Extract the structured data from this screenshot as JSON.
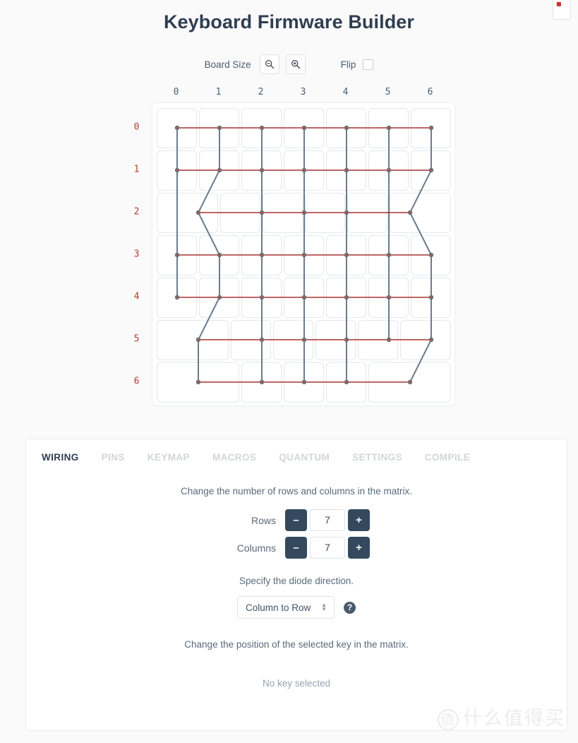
{
  "header": {
    "title": "Keyboard Firmware Builder"
  },
  "toolbar": {
    "board_size_label": "Board Size",
    "zoom_out_icon": "zoom-out-icon",
    "zoom_in_icon": "zoom-in-icon",
    "flip_label": "Flip",
    "flip_checked": false
  },
  "matrix": {
    "col_labels": [
      "0",
      "1",
      "2",
      "3",
      "4",
      "5",
      "6"
    ],
    "row_labels": [
      "0",
      "1",
      "2",
      "3",
      "4",
      "5",
      "6"
    ],
    "rows": 7,
    "cols": 7,
    "colors": {
      "row_wire": "#a83232",
      "col_wire": "#6b7c8c",
      "node": "#7a6a6a",
      "col_label": "#4a6076",
      "row_label": "#c0392b"
    },
    "layout": [
      {
        "row": 0,
        "keys": [
          {
            "x": 0,
            "w": 1
          },
          {
            "x": 1,
            "w": 1
          },
          {
            "x": 2,
            "w": 1
          },
          {
            "x": 3,
            "w": 1
          },
          {
            "x": 4,
            "w": 1
          },
          {
            "x": 5,
            "w": 1
          },
          {
            "x": 6,
            "w": 1
          }
        ]
      },
      {
        "row": 1,
        "keys": [
          {
            "x": 0,
            "w": 1
          },
          {
            "x": 1,
            "w": 1
          },
          {
            "x": 2,
            "w": 1
          },
          {
            "x": 3,
            "w": 1
          },
          {
            "x": 4,
            "w": 1
          },
          {
            "x": 5,
            "w": 1
          },
          {
            "x": 6,
            "w": 1
          }
        ]
      },
      {
        "row": 2,
        "keys": [
          {
            "x": 0,
            "w": 1.5
          },
          {
            "x": 1.5,
            "w": 1
          },
          {
            "x": 2.5,
            "w": 1
          },
          {
            "x": 3.5,
            "w": 1
          },
          {
            "x": 4.5,
            "w": 1
          },
          {
            "x": 5.5,
            "w": 1.5
          }
        ]
      },
      {
        "row": 3,
        "keys": [
          {
            "x": 0,
            "w": 1
          },
          {
            "x": 1,
            "w": 1
          },
          {
            "x": 2,
            "w": 1
          },
          {
            "x": 3,
            "w": 1
          },
          {
            "x": 4,
            "w": 1
          },
          {
            "x": 5,
            "w": 1
          },
          {
            "x": 6,
            "w": 1
          }
        ]
      },
      {
        "row": 4,
        "keys": [
          {
            "x": 0,
            "w": 1
          },
          {
            "x": 1,
            "w": 1
          },
          {
            "x": 2,
            "w": 1
          },
          {
            "x": 3,
            "w": 1
          },
          {
            "x": 4,
            "w": 1
          },
          {
            "x": 5,
            "w": 1
          },
          {
            "x": 6,
            "w": 1
          }
        ]
      },
      {
        "row": 5,
        "keys": [
          {
            "x": 0,
            "w": 1.75
          },
          {
            "x": 1.75,
            "w": 1
          },
          {
            "x": 2.75,
            "w": 1
          },
          {
            "x": 3.75,
            "w": 1
          },
          {
            "x": 4.75,
            "w": 1
          },
          {
            "x": 5.75,
            "w": 1.25
          }
        ]
      },
      {
        "row": 6,
        "keys": [
          {
            "x": 0,
            "w": 2
          },
          {
            "x": 2,
            "w": 1
          },
          {
            "x": 3,
            "w": 1
          },
          {
            "x": 4,
            "w": 1
          },
          {
            "x": 5,
            "w": 2
          }
        ]
      }
    ],
    "nodes": [
      {
        "row": 0,
        "xs": [
          0.5,
          1.5,
          2.5,
          3.5,
          4.5,
          5.5,
          6.5
        ]
      },
      {
        "row": 1,
        "xs": [
          0.5,
          1.5,
          2.5,
          3.5,
          4.5,
          5.5,
          6.5
        ]
      },
      {
        "row": 2,
        "xs": [
          1.0,
          2.5,
          3.5,
          4.5,
          6.0
        ]
      },
      {
        "row": 3,
        "xs": [
          0.5,
          1.5,
          2.5,
          3.5,
          4.5,
          5.5,
          6.5
        ]
      },
      {
        "row": 4,
        "xs": [
          0.5,
          1.5,
          2.5,
          3.5,
          4.5,
          5.5,
          6.5
        ]
      },
      {
        "row": 5,
        "xs": [
          1.0,
          2.5,
          3.5,
          4.5,
          5.5,
          6.5
        ]
      },
      {
        "row": 6,
        "xs": [
          1.0,
          2.5,
          3.5,
          4.5,
          6.0
        ]
      }
    ],
    "col_paths": [
      {
        "col": 0,
        "points": [
          [
            0.5,
            0
          ],
          [
            0.5,
            1
          ],
          [
            0.5,
            3
          ],
          [
            0.5,
            4
          ]
        ]
      },
      {
        "col": 1,
        "points": [
          [
            1.5,
            0
          ],
          [
            1.5,
            1
          ],
          [
            1.0,
            2
          ],
          [
            1.5,
            3
          ],
          [
            1.5,
            4
          ],
          [
            1.0,
            5
          ],
          [
            1.0,
            6
          ]
        ]
      },
      {
        "col": 2,
        "points": [
          [
            2.5,
            0
          ],
          [
            2.5,
            1
          ],
          [
            2.5,
            2
          ],
          [
            2.5,
            3
          ],
          [
            2.5,
            4
          ],
          [
            2.5,
            5
          ],
          [
            2.5,
            6
          ]
        ]
      },
      {
        "col": 3,
        "points": [
          [
            3.5,
            0
          ],
          [
            3.5,
            1
          ],
          [
            3.5,
            2
          ],
          [
            3.5,
            3
          ],
          [
            3.5,
            4
          ],
          [
            3.5,
            5
          ],
          [
            3.5,
            6
          ]
        ]
      },
      {
        "col": 4,
        "points": [
          [
            4.5,
            0
          ],
          [
            4.5,
            1
          ],
          [
            4.5,
            2
          ],
          [
            4.5,
            3
          ],
          [
            4.5,
            4
          ],
          [
            4.5,
            5
          ],
          [
            4.5,
            6
          ]
        ]
      },
      {
        "col": 5,
        "points": [
          [
            5.5,
            0
          ],
          [
            5.5,
            1
          ],
          [
            5.5,
            3
          ],
          [
            5.5,
            4
          ],
          [
            5.5,
            5
          ]
        ]
      },
      {
        "col": 6,
        "points": [
          [
            6.5,
            0
          ],
          [
            6.5,
            1
          ],
          [
            6.0,
            2
          ],
          [
            6.5,
            3
          ],
          [
            6.5,
            4
          ],
          [
            6.5,
            5
          ],
          [
            6.0,
            6
          ]
        ]
      }
    ]
  },
  "panel": {
    "tabs": [
      {
        "label": "WIRING",
        "active": true
      },
      {
        "label": "PINS",
        "active": false
      },
      {
        "label": "KEYMAP",
        "active": false
      },
      {
        "label": "MACROS",
        "active": false
      },
      {
        "label": "QUANTUM",
        "active": false
      },
      {
        "label": "SETTINGS",
        "active": false
      },
      {
        "label": "COMPILE",
        "active": false
      }
    ],
    "matrix_desc": "Change the number of rows and columns in the matrix.",
    "rows_label": "Rows",
    "rows_value": "7",
    "columns_label": "Columns",
    "columns_value": "7",
    "minus_label": "–",
    "plus_label": "+",
    "diode_desc": "Specify the diode direction.",
    "diode_value": "Column to Row",
    "help_label": "?",
    "position_desc": "Change the position of the selected key in the matrix.",
    "no_key_selected": "No key selected"
  },
  "watermark": {
    "circle": "值",
    "text": "什么值得买"
  }
}
